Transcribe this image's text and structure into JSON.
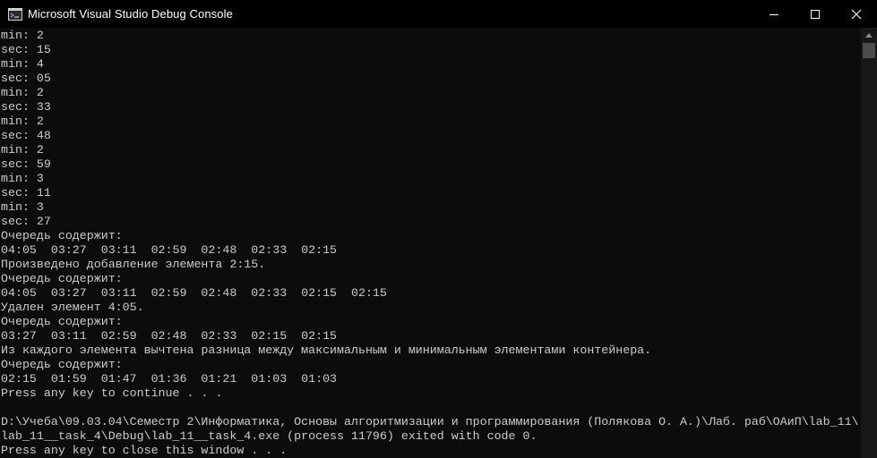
{
  "window": {
    "title": "Microsoft Visual Studio Debug Console",
    "app_icon": "console-app-icon",
    "controls": {
      "minimize_icon": "minimize-icon",
      "maximize_icon": "maximize-icon",
      "close_icon": "close-icon"
    }
  },
  "console": {
    "lines": [
      "min: 2",
      "sec: 15",
      "min: 4",
      "sec: 05",
      "min: 2",
      "sec: 33",
      "min: 2",
      "sec: 48",
      "min: 2",
      "sec: 59",
      "min: 3",
      "sec: 11",
      "min: 3",
      "sec: 27",
      "Очередь содержит:",
      "04:05  03:27  03:11  02:59  02:48  02:33  02:15",
      "Произведено добавление элемента 2:15.",
      "Очередь содержит:",
      "04:05  03:27  03:11  02:59  02:48  02:33  02:15  02:15",
      "Удален элемент 4:05.",
      "Очередь содержит:",
      "03:27  03:11  02:59  02:48  02:33  02:15  02:15",
      "Из каждого элемента вычтена разница между максимальным и минимальным элементами контейнера.",
      "Очередь содержит:",
      "02:15  01:59  01:47  01:36  01:21  01:03  01:03",
      "Press any key to continue . . .",
      "",
      "D:\\Учеба\\09.03.04\\Семестр 2\\Информатика, Основы алгоритмизации и программирования (Полякова О. А.)\\Лаб. раб\\ОАиП\\lab_11\\",
      "lab_11__task_4\\Debug\\lab_11__task_4.exe (process 11796) exited with code 0.",
      "Press any key to close this window . . ."
    ]
  },
  "colors": {
    "background": "#0c0c0c",
    "foreground": "#cccccc",
    "titlebar": "#000000"
  }
}
